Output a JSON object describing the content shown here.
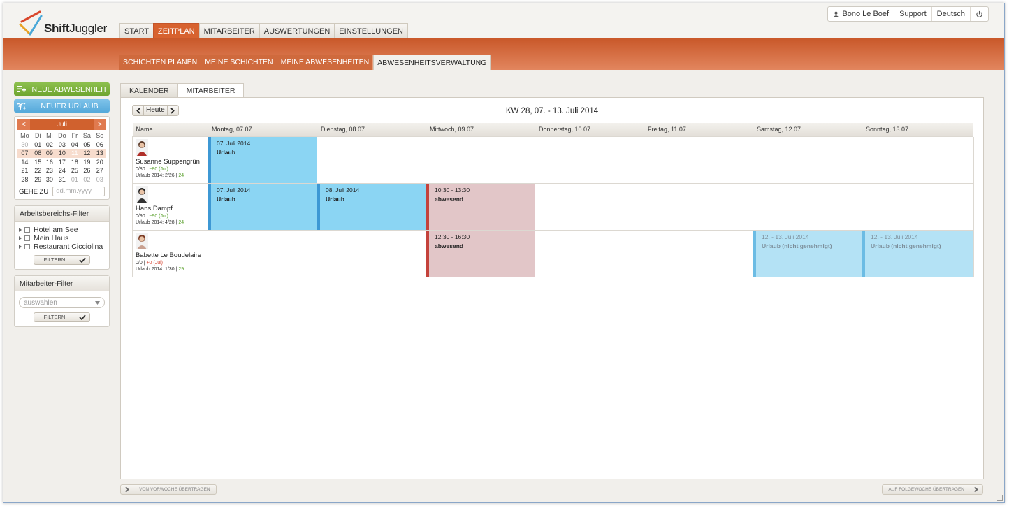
{
  "app": {
    "logo_bold": "Shift",
    "logo_light": "Juggler"
  },
  "user_menu": {
    "user_name": "Bono Le Boef",
    "support": "Support",
    "language": "Deutsch"
  },
  "main_nav": [
    "START",
    "ZEITPLAN",
    "MITARBEITER",
    "AUSWERTUNGEN",
    "EINSTELLUNGEN"
  ],
  "sub_nav": [
    "SCHICHTEN PLANEN",
    "MEINE SCHICHTEN",
    "MEINE ABWESENHEITEN",
    "ABWESENHEITSVERWALTUNG"
  ],
  "sidebar": {
    "new_absence": "NEUE ABWESENHEIT",
    "new_vacation": "NEUER URLAUB",
    "calendar": {
      "month": "Juli",
      "prev": "<",
      "next": ">",
      "weekdays": [
        "Mo",
        "Di",
        "Mi",
        "Do",
        "Fr",
        "Sa",
        "So"
      ],
      "weeks": [
        [
          "30",
          "01",
          "02",
          "03",
          "04",
          "05",
          "06"
        ],
        [
          "07",
          "08",
          "09",
          "10",
          "11",
          "12",
          "13"
        ],
        [
          "14",
          "15",
          "16",
          "17",
          "18",
          "19",
          "20"
        ],
        [
          "21",
          "22",
          "23",
          "24",
          "25",
          "26",
          "27"
        ],
        [
          "28",
          "29",
          "30",
          "31",
          "01",
          "02",
          "03"
        ]
      ],
      "goto_label": "GEHE ZU",
      "goto_placeholder": "dd.mm.yyyy"
    },
    "area_filter": {
      "title": "Arbeitsbereichs-Filter",
      "items": [
        "Hotel am See",
        "Mein Haus",
        "Restaurant Cicciolina"
      ],
      "button": "FILTERN"
    },
    "employee_filter": {
      "title": "Mitarbeiter-Filter",
      "select": "auswählen",
      "button": "FILTERN"
    }
  },
  "tabs": [
    "KALENDER",
    "MITARBEITER"
  ],
  "toolbar": {
    "today": "Heute",
    "week_title": "KW 28, 07. - 13. Juli 2014"
  },
  "grid": {
    "headers": [
      "Name",
      "Montag, 07.07.",
      "Dienstag, 08.07.",
      "Mittwoch, 09.07.",
      "Donnerstag, 10.07.",
      "Freitag, 11.07.",
      "Samstag, 12.07.",
      "Sonntag, 13.07."
    ],
    "rows": [
      {
        "name": "Susanne Suppengrün",
        "hours": "0/80",
        "delta": "−80 (Jul)",
        "vacation": "Urlaub 2014: 2/26",
        "vacation_left": "24",
        "events": [
          {
            "day": 1,
            "kind": "urlaub",
            "line1": "07. Juli 2014",
            "line2": "Urlaub"
          }
        ]
      },
      {
        "name": "Hans Dampf",
        "hours": "0/90",
        "delta": "−90 (Jul)",
        "vacation": "Urlaub 2014: 4/28",
        "vacation_left": "24",
        "events": [
          {
            "day": 1,
            "kind": "urlaub",
            "line1": "07. Juli 2014",
            "line2": "Urlaub"
          },
          {
            "day": 2,
            "kind": "urlaub",
            "line1": "08. Juli 2014",
            "line2": "Urlaub"
          },
          {
            "day": 3,
            "kind": "absent",
            "line1": "10:30 - 13:30",
            "line2": "abwesend"
          }
        ]
      },
      {
        "name": "Babette Le Boudelaire",
        "hours": "0/0",
        "delta": "+0 (Jul)",
        "vacation": "Urlaub 2014: 1/30",
        "vacation_left": "29",
        "events": [
          {
            "day": 3,
            "kind": "absent",
            "line1": "12:30 - 16:30",
            "line2": "abwesend"
          },
          {
            "day": 6,
            "kind": "pending",
            "line1": "12. - 13. Juli 2014",
            "line2": "Urlaub (nicht genehmigt)"
          },
          {
            "day": 7,
            "kind": "pending",
            "line1": "12. - 13. Juli 2014",
            "line2": "Urlaub (nicht genehmigt)"
          }
        ]
      }
    ]
  },
  "bottom": {
    "prev_week": "VON VORWOCHE ÜBERTRAGEN",
    "next_week": "AUF FOLGEWOCHE ÜBERTRAGEN"
  },
  "colors": {
    "accent": "#d7622f",
    "vacation": "#8bd5f3",
    "absent": "#e2c6c8",
    "pending": "#b4e2f5"
  }
}
